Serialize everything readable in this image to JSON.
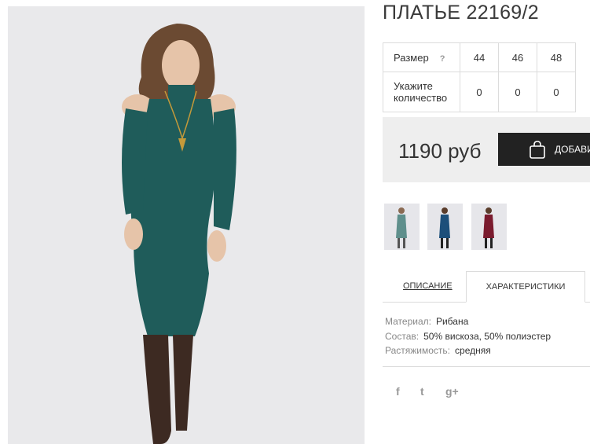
{
  "product": {
    "title": "ПЛАТЬЕ 22169/2",
    "price": "1190 руб",
    "add_to_cart_label": "ДОБАВИТЬ"
  },
  "size_table": {
    "size_label": "Размер",
    "help_mark": "?",
    "sizes": [
      "44",
      "46",
      "48"
    ],
    "qty_label_line1": "Укажите",
    "qty_label_line2": "количество",
    "quantities": [
      "0",
      "0",
      "0"
    ]
  },
  "colors": {
    "photo_background": "#e9e9eb",
    "dress_main": "#1f5c5a",
    "button": "#222222",
    "price_band": "#eeeeee",
    "variants": [
      "#5f8f8c",
      "#1d4f7a",
      "#7a1b2e"
    ]
  },
  "tabs": {
    "description": "ОПИСАНИЕ",
    "characteristics": "ХАРАКТЕРИСТИКИ"
  },
  "specs": [
    {
      "key": "Материал:",
      "value": "Рибана"
    },
    {
      "key": "Состав:",
      "value": "50% вискоза, 50% полиэстер"
    },
    {
      "key": "Растяжимость:",
      "value": "средняя"
    }
  ],
  "social": {
    "facebook": "f",
    "twitter": "t",
    "googleplus": "g+"
  }
}
